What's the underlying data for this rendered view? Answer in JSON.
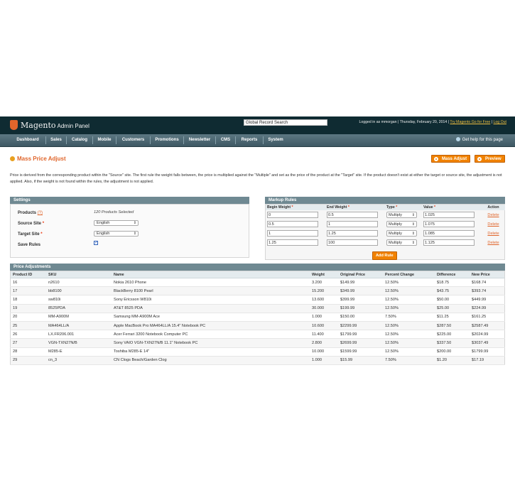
{
  "header": {
    "logo_text": "Magento",
    "logo_sub": "Admin Panel",
    "search_value": "Global Record Search",
    "user_info": "Logged in as mmorgan",
    "date": "Thursday, February 20, 2014",
    "try_link": "Try Magento Go for Free",
    "logout": "Log Out"
  },
  "nav": {
    "items": [
      "Dashboard",
      "Sales",
      "Catalog",
      "Mobile",
      "Customers",
      "Promotions",
      "Newsletter",
      "CMS",
      "Reports",
      "System"
    ],
    "help": "Get help for this page"
  },
  "page": {
    "title": "Mass Price Adjust",
    "btn_mass": "Mass Adjust",
    "btn_preview": "Preview",
    "description": "Price is derived from the corresponding product within the \"Source\" site. The first rule the weight falls between, the price is multiplied against the \"Multiple\" and set as the price of the product at the \"Target\" site. If the product doesn't exist at either the target or source site, the adjustment is not applied. Also, if the weight is not found within the rules, the adjustment is not applied."
  },
  "settings": {
    "header": "Settings",
    "products_label": "Products",
    "products_help": "(?)",
    "products_value": "120 Products Selected",
    "source_label": "Source Site",
    "source_value": "English",
    "target_label": "Target Site",
    "target_value": "English",
    "save_label": "Save Rules",
    "required": "*"
  },
  "markup": {
    "header": "Markup Rules",
    "columns": [
      "Begin Weight",
      "End Weight",
      "Type",
      "Value",
      "Action"
    ],
    "rows": [
      {
        "begin": "0",
        "end": "0.5",
        "type": "Multiply",
        "value": "1.025",
        "action": "Delete"
      },
      {
        "begin": "0.5",
        "end": "1",
        "type": "Multiply",
        "value": "1.075",
        "action": "Delete"
      },
      {
        "begin": "1",
        "end": "1.25",
        "type": "Multiply",
        "value": "1.085",
        "action": "Delete"
      },
      {
        "begin": "1.25",
        "end": "100",
        "type": "Multiply",
        "value": "1.125",
        "action": "Delete"
      }
    ],
    "add_rule": "Add Rule"
  },
  "adjustments": {
    "header": "Price Adjustments",
    "columns": [
      "Product ID",
      "SKU",
      "Name",
      "Weight",
      "Original Price",
      "Percent Change",
      "Difference",
      "New Price"
    ],
    "rows": [
      [
        "16",
        "n2610",
        "Nokia 2610 Phone",
        "3.200",
        "$149.99",
        "12.50%",
        "$18.75",
        "$168.74"
      ],
      [
        "17",
        "bb8100",
        "BlackBerry 8100 Pearl",
        "15.200",
        "$349.99",
        "12.50%",
        "$43.75",
        "$393.74"
      ],
      [
        "18",
        "sw810i",
        "Sony Ericsson W810i",
        "13.600",
        "$399.99",
        "12.50%",
        "$50.00",
        "$449.99"
      ],
      [
        "19",
        "8525PDA",
        "AT&T 8525 PDA",
        "30.000",
        "$199.99",
        "12.50%",
        "$25.00",
        "$224.99"
      ],
      [
        "20",
        "MM-A900M",
        "Samsung MM-A900M Ace",
        "1.000",
        "$150.00",
        "7.50%",
        "$11.25",
        "$161.25"
      ],
      [
        "25",
        "MA464LL/A",
        "Apple MacBook Pro MA464LL/A 15.4\" Notebook PC",
        "10.600",
        "$2299.99",
        "12.50%",
        "$287.50",
        "$2587.49"
      ],
      [
        "26",
        "LX.FR206.001",
        "Acer Ferrari 3200 Notebook Computer PC",
        "11.400",
        "$1799.99",
        "12.50%",
        "$225.00",
        "$2024.99"
      ],
      [
        "27",
        "VGN-TXN27N/B",
        "Sony VAIO VGN-TXN27N/B 11.1\" Notebook PC",
        "2.800",
        "$2699.99",
        "12.50%",
        "$337.50",
        "$3037.49"
      ],
      [
        "28",
        "M285-E",
        "Toshiba M285-E 14\"",
        "10.000",
        "$1599.99",
        "12.50%",
        "$200.00",
        "$1799.99"
      ],
      [
        "29",
        "cn_3",
        "CN Clogs Beach/Garden Clog",
        "1.000",
        "$15.99",
        "7.50%",
        "$1.20",
        "$17.19"
      ]
    ]
  }
}
